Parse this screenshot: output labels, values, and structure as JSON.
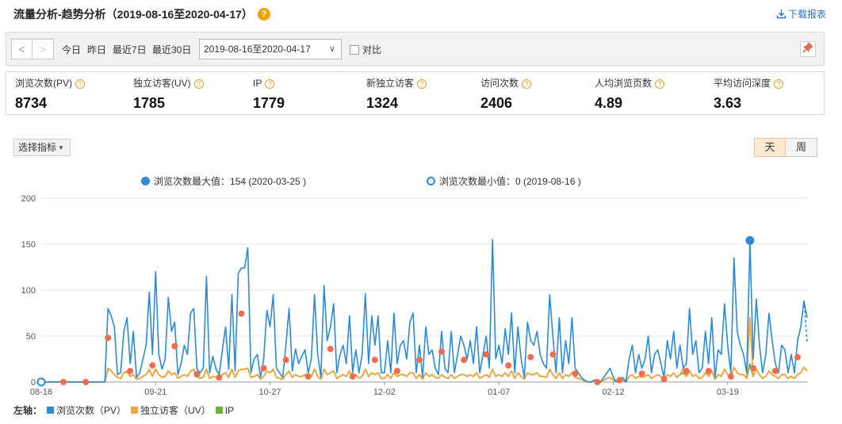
{
  "header": {
    "title": "流量分析-趋势分析（2019-08-16至2020-04-17）",
    "help": "?",
    "download": "下载报表"
  },
  "toolbar": {
    "prev": "<",
    "next": ">",
    "quick_ranges": [
      "今日",
      "昨日",
      "最近7日",
      "最近30日"
    ],
    "date_range": "2019-08-16至2020-04-17",
    "compare_label": "对比"
  },
  "metrics": [
    {
      "label": "浏览次数(PV)",
      "value": "8734"
    },
    {
      "label": "独立访客(UV)",
      "value": "1785"
    },
    {
      "label": "IP",
      "value": "1779"
    },
    {
      "label": "新独立访客",
      "value": "1324"
    },
    {
      "label": "访问次数",
      "value": "2406"
    },
    {
      "label": "人均浏览页数",
      "value": "4.89"
    },
    {
      "label": "平均访问深度",
      "value": "3.63"
    }
  ],
  "controls": {
    "selector": "选择指标",
    "day": "天",
    "week": "周"
  },
  "chart_legend": {
    "max": "浏览次数最大值：154 (2020-03-25 )",
    "min": "浏览次数最小值：0 (2019-08-16 )"
  },
  "bottom_legend": {
    "prefix": "左轴：",
    "items": [
      "浏览次数（PV）",
      "独立访客（UV）",
      "IP"
    ]
  },
  "colors": {
    "pv": "#2d8ad6",
    "uv": "#f0a640",
    "ip": "#6db33f",
    "marker": "#f26c4f"
  },
  "chart_data": {
    "type": "line",
    "x_ticks": [
      "08-16",
      "09-21",
      "10-27",
      "12-02",
      "01-07",
      "02-12",
      "03-19"
    ],
    "y_ticks": [
      0,
      50,
      100,
      150,
      200
    ],
    "ylim": [
      0,
      200
    ],
    "series": [
      {
        "name": "浏览次数（PV）",
        "values": [
          0,
          0,
          0,
          0,
          0,
          0,
          0,
          0,
          0,
          0,
          0,
          0,
          0,
          0,
          0,
          0,
          0,
          0,
          0,
          0,
          0,
          80,
          72,
          60,
          8,
          10,
          55,
          70,
          20,
          55,
          5,
          10,
          25,
          40,
          98,
          30,
          120,
          30,
          14,
          25,
          92,
          55,
          65,
          8,
          20,
          40,
          30,
          75,
          80,
          14,
          10,
          15,
          115,
          10,
          28,
          14,
          8,
          35,
          60,
          14,
          95,
          12,
          118,
          124,
          124,
          146,
          10,
          25,
          30,
          5,
          25,
          78,
          60,
          95,
          15,
          10,
          5,
          40,
          80,
          12,
          36,
          20,
          28,
          35,
          10,
          25,
          95,
          30,
          5,
          105,
          45,
          60,
          85,
          10,
          30,
          40,
          20,
          72,
          10,
          35,
          10,
          30,
          96,
          20,
          72,
          40,
          72,
          10,
          10,
          45,
          10,
          75,
          20,
          40,
          45,
          25,
          65,
          75,
          10,
          40,
          5,
          60,
          30,
          35,
          15,
          8,
          55,
          15,
          10,
          55,
          10,
          30,
          50,
          40,
          25,
          45,
          20,
          60,
          10,
          30,
          50,
          15,
          155,
          25,
          40,
          20,
          58,
          30,
          75,
          10,
          60,
          25,
          5,
          65,
          45,
          40,
          55,
          30,
          20,
          15,
          95,
          50,
          10,
          70,
          10,
          45,
          20,
          70,
          15,
          10,
          5,
          2,
          0,
          0,
          2,
          0,
          0,
          5,
          10,
          15,
          5,
          0,
          3,
          5,
          0,
          25,
          40,
          10,
          30,
          15,
          25,
          50,
          10,
          30,
          35,
          20,
          5,
          45,
          25,
          55,
          15,
          40,
          15,
          20,
          80,
          30,
          45,
          10,
          15,
          55,
          20,
          70,
          5,
          35,
          30,
          85,
          40,
          10,
          135,
          55,
          40,
          30,
          10,
          154,
          25,
          90,
          40,
          10,
          30,
          75,
          45,
          20,
          10,
          40,
          35,
          10,
          30,
          10,
          45,
          60,
          88,
          70
        ]
      },
      {
        "name": "独立访客（UV）",
        "values": [
          0,
          0,
          0,
          0,
          0,
          0,
          0,
          0,
          0,
          0,
          0,
          0,
          0,
          0,
          0,
          0,
          0,
          0,
          0,
          0,
          0,
          15,
          12,
          8,
          5,
          4,
          10,
          12,
          6,
          8,
          3,
          4,
          6,
          8,
          14,
          6,
          14,
          8,
          5,
          6,
          12,
          8,
          10,
          4,
          6,
          8,
          6,
          12,
          14,
          6,
          4,
          5,
          14,
          4,
          6,
          5,
          4,
          8,
          10,
          5,
          14,
          5,
          12,
          14,
          14,
          15,
          5,
          6,
          8,
          3,
          6,
          12,
          10,
          14,
          5,
          4,
          3,
          8,
          12,
          5,
          8,
          6,
          6,
          8,
          4,
          6,
          14,
          6,
          3,
          14,
          8,
          10,
          12,
          4,
          6,
          8,
          6,
          12,
          4,
          8,
          4,
          6,
          14,
          6,
          10,
          8,
          10,
          4,
          4,
          8,
          4,
          10,
          6,
          8,
          8,
          6,
          10,
          10,
          4,
          8,
          3,
          10,
          6,
          8,
          5,
          4,
          8,
          5,
          4,
          8,
          4,
          6,
          8,
          8,
          6,
          8,
          6,
          10,
          4,
          6,
          8,
          5,
          14,
          6,
          8,
          6,
          10,
          6,
          12,
          4,
          10,
          6,
          3,
          10,
          8,
          8,
          10,
          6,
          6,
          5,
          14,
          8,
          4,
          10,
          4,
          8,
          6,
          10,
          5,
          4,
          3,
          1,
          0,
          0,
          1,
          0,
          0,
          2,
          4,
          5,
          2,
          0,
          1,
          2,
          0,
          6,
          8,
          4,
          6,
          5,
          6,
          8,
          4,
          6,
          8,
          6,
          3,
          8,
          6,
          10,
          5,
          8,
          15,
          6,
          12,
          6,
          8,
          4,
          5,
          10,
          6,
          12,
          3,
          8,
          6,
          14,
          8,
          4,
          16,
          10,
          8,
          8,
          4,
          70,
          6,
          14,
          8,
          4,
          6,
          12,
          8,
          6,
          4,
          8,
          8,
          4,
          6,
          4,
          8,
          10,
          16,
          12
        ]
      },
      {
        "name": "IP",
        "values": [
          0,
          0,
          0,
          0,
          0,
          0,
          0,
          0,
          0,
          0,
          0,
          0,
          0,
          0,
          0,
          0,
          0,
          0,
          0,
          0,
          0,
          14,
          12,
          8,
          5,
          4,
          10,
          11,
          6,
          8,
          3,
          4,
          6,
          8,
          13,
          6,
          14,
          8,
          5,
          6,
          12,
          8,
          10,
          4,
          6,
          8,
          6,
          12,
          14,
          6,
          4,
          5,
          14,
          4,
          6,
          5,
          4,
          8,
          10,
          5,
          14,
          5,
          12,
          14,
          14,
          15,
          5,
          6,
          8,
          3,
          6,
          12,
          10,
          14,
          5,
          4,
          3,
          8,
          12,
          5,
          8,
          6,
          6,
          8,
          4,
          6,
          14,
          6,
          3,
          14,
          8,
          10,
          12,
          4,
          6,
          8,
          6,
          12,
          4,
          8,
          4,
          6,
          14,
          6,
          10,
          8,
          10,
          4,
          4,
          8,
          4,
          10,
          6,
          8,
          8,
          6,
          10,
          10,
          4,
          8,
          3,
          10,
          6,
          8,
          5,
          4,
          8,
          5,
          4,
          8,
          4,
          6,
          8,
          8,
          6,
          8,
          6,
          10,
          4,
          6,
          8,
          5,
          14,
          6,
          8,
          6,
          10,
          6,
          12,
          4,
          10,
          6,
          3,
          10,
          8,
          8,
          10,
          6,
          6,
          5,
          14,
          8,
          4,
          10,
          4,
          8,
          6,
          10,
          5,
          4,
          3,
          1,
          0,
          0,
          1,
          0,
          0,
          2,
          4,
          5,
          2,
          0,
          1,
          2,
          0,
          6,
          8,
          4,
          6,
          5,
          6,
          8,
          4,
          6,
          8,
          6,
          3,
          8,
          6,
          10,
          5,
          8,
          10,
          6,
          12,
          6,
          8,
          4,
          5,
          10,
          6,
          12,
          3,
          8,
          6,
          14,
          8,
          4,
          16,
          10,
          8,
          8,
          4,
          20,
          6,
          14,
          8,
          4,
          6,
          12,
          8,
          6,
          4,
          8,
          8,
          4,
          6,
          4,
          8,
          10,
          16,
          12
        ]
      }
    ],
    "max_point": {
      "value": 154,
      "date": "2020-03-25"
    },
    "min_point": {
      "value": 0,
      "date": "2019-08-16"
    }
  }
}
